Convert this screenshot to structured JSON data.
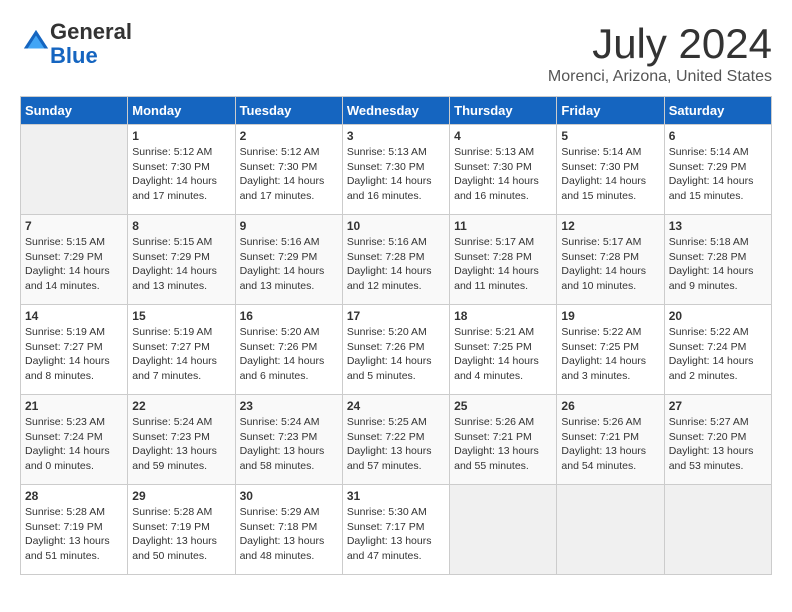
{
  "logo": {
    "general": "General",
    "blue": "Blue"
  },
  "title": "July 2024",
  "location": "Morenci, Arizona, United States",
  "days_of_week": [
    "Sunday",
    "Monday",
    "Tuesday",
    "Wednesday",
    "Thursday",
    "Friday",
    "Saturday"
  ],
  "weeks": [
    [
      {
        "day": "",
        "info": ""
      },
      {
        "day": "1",
        "info": "Sunrise: 5:12 AM\nSunset: 7:30 PM\nDaylight: 14 hours\nand 17 minutes."
      },
      {
        "day": "2",
        "info": "Sunrise: 5:12 AM\nSunset: 7:30 PM\nDaylight: 14 hours\nand 17 minutes."
      },
      {
        "day": "3",
        "info": "Sunrise: 5:13 AM\nSunset: 7:30 PM\nDaylight: 14 hours\nand 16 minutes."
      },
      {
        "day": "4",
        "info": "Sunrise: 5:13 AM\nSunset: 7:30 PM\nDaylight: 14 hours\nand 16 minutes."
      },
      {
        "day": "5",
        "info": "Sunrise: 5:14 AM\nSunset: 7:30 PM\nDaylight: 14 hours\nand 15 minutes."
      },
      {
        "day": "6",
        "info": "Sunrise: 5:14 AM\nSunset: 7:29 PM\nDaylight: 14 hours\nand 15 minutes."
      }
    ],
    [
      {
        "day": "7",
        "info": "Sunrise: 5:15 AM\nSunset: 7:29 PM\nDaylight: 14 hours\nand 14 minutes."
      },
      {
        "day": "8",
        "info": "Sunrise: 5:15 AM\nSunset: 7:29 PM\nDaylight: 14 hours\nand 13 minutes."
      },
      {
        "day": "9",
        "info": "Sunrise: 5:16 AM\nSunset: 7:29 PM\nDaylight: 14 hours\nand 13 minutes."
      },
      {
        "day": "10",
        "info": "Sunrise: 5:16 AM\nSunset: 7:28 PM\nDaylight: 14 hours\nand 12 minutes."
      },
      {
        "day": "11",
        "info": "Sunrise: 5:17 AM\nSunset: 7:28 PM\nDaylight: 14 hours\nand 11 minutes."
      },
      {
        "day": "12",
        "info": "Sunrise: 5:17 AM\nSunset: 7:28 PM\nDaylight: 14 hours\nand 10 minutes."
      },
      {
        "day": "13",
        "info": "Sunrise: 5:18 AM\nSunset: 7:28 PM\nDaylight: 14 hours\nand 9 minutes."
      }
    ],
    [
      {
        "day": "14",
        "info": "Sunrise: 5:19 AM\nSunset: 7:27 PM\nDaylight: 14 hours\nand 8 minutes."
      },
      {
        "day": "15",
        "info": "Sunrise: 5:19 AM\nSunset: 7:27 PM\nDaylight: 14 hours\nand 7 minutes."
      },
      {
        "day": "16",
        "info": "Sunrise: 5:20 AM\nSunset: 7:26 PM\nDaylight: 14 hours\nand 6 minutes."
      },
      {
        "day": "17",
        "info": "Sunrise: 5:20 AM\nSunset: 7:26 PM\nDaylight: 14 hours\nand 5 minutes."
      },
      {
        "day": "18",
        "info": "Sunrise: 5:21 AM\nSunset: 7:25 PM\nDaylight: 14 hours\nand 4 minutes."
      },
      {
        "day": "19",
        "info": "Sunrise: 5:22 AM\nSunset: 7:25 PM\nDaylight: 14 hours\nand 3 minutes."
      },
      {
        "day": "20",
        "info": "Sunrise: 5:22 AM\nSunset: 7:24 PM\nDaylight: 14 hours\nand 2 minutes."
      }
    ],
    [
      {
        "day": "21",
        "info": "Sunrise: 5:23 AM\nSunset: 7:24 PM\nDaylight: 14 hours\nand 0 minutes."
      },
      {
        "day": "22",
        "info": "Sunrise: 5:24 AM\nSunset: 7:23 PM\nDaylight: 13 hours\nand 59 minutes."
      },
      {
        "day": "23",
        "info": "Sunrise: 5:24 AM\nSunset: 7:23 PM\nDaylight: 13 hours\nand 58 minutes."
      },
      {
        "day": "24",
        "info": "Sunrise: 5:25 AM\nSunset: 7:22 PM\nDaylight: 13 hours\nand 57 minutes."
      },
      {
        "day": "25",
        "info": "Sunrise: 5:26 AM\nSunset: 7:21 PM\nDaylight: 13 hours\nand 55 minutes."
      },
      {
        "day": "26",
        "info": "Sunrise: 5:26 AM\nSunset: 7:21 PM\nDaylight: 13 hours\nand 54 minutes."
      },
      {
        "day": "27",
        "info": "Sunrise: 5:27 AM\nSunset: 7:20 PM\nDaylight: 13 hours\nand 53 minutes."
      }
    ],
    [
      {
        "day": "28",
        "info": "Sunrise: 5:28 AM\nSunset: 7:19 PM\nDaylight: 13 hours\nand 51 minutes."
      },
      {
        "day": "29",
        "info": "Sunrise: 5:28 AM\nSunset: 7:19 PM\nDaylight: 13 hours\nand 50 minutes."
      },
      {
        "day": "30",
        "info": "Sunrise: 5:29 AM\nSunset: 7:18 PM\nDaylight: 13 hours\nand 48 minutes."
      },
      {
        "day": "31",
        "info": "Sunrise: 5:30 AM\nSunset: 7:17 PM\nDaylight: 13 hours\nand 47 minutes."
      },
      {
        "day": "",
        "info": ""
      },
      {
        "day": "",
        "info": ""
      },
      {
        "day": "",
        "info": ""
      }
    ]
  ]
}
